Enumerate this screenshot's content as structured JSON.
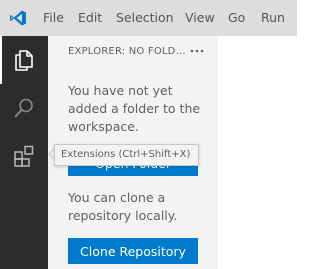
{
  "menu": [
    {
      "id": "file",
      "label": "File"
    },
    {
      "id": "edit",
      "label": "Edit"
    },
    {
      "id": "selection",
      "label": "Selection"
    },
    {
      "id": "view",
      "label": "View"
    },
    {
      "id": "go",
      "label": "Go"
    },
    {
      "id": "run",
      "label": "Run"
    }
  ],
  "activity_bar": {
    "items": [
      {
        "icon": "files-icon",
        "active": true
      },
      {
        "icon": "search-icon",
        "active": false
      },
      {
        "icon": "extensions-icon",
        "active": false
      }
    ]
  },
  "sidebar": {
    "title": "EXPLORER: NO FOLD...",
    "more_actions_icon": "ellipsis-icon",
    "no_folder_message": "You have not yet added a folder to the workspace.",
    "open_folder_label": "Open Folder",
    "clone_message": "You can clone a repository locally.",
    "clone_label": "Clone Repository"
  },
  "tooltip": {
    "text": "Extensions (Ctrl+Shift+X)"
  },
  "colors": {
    "accent": "#007acc",
    "titlebar": "#dddddd",
    "activity_bar": "#2c2c2c",
    "sidebar": "#f3f3f3"
  }
}
